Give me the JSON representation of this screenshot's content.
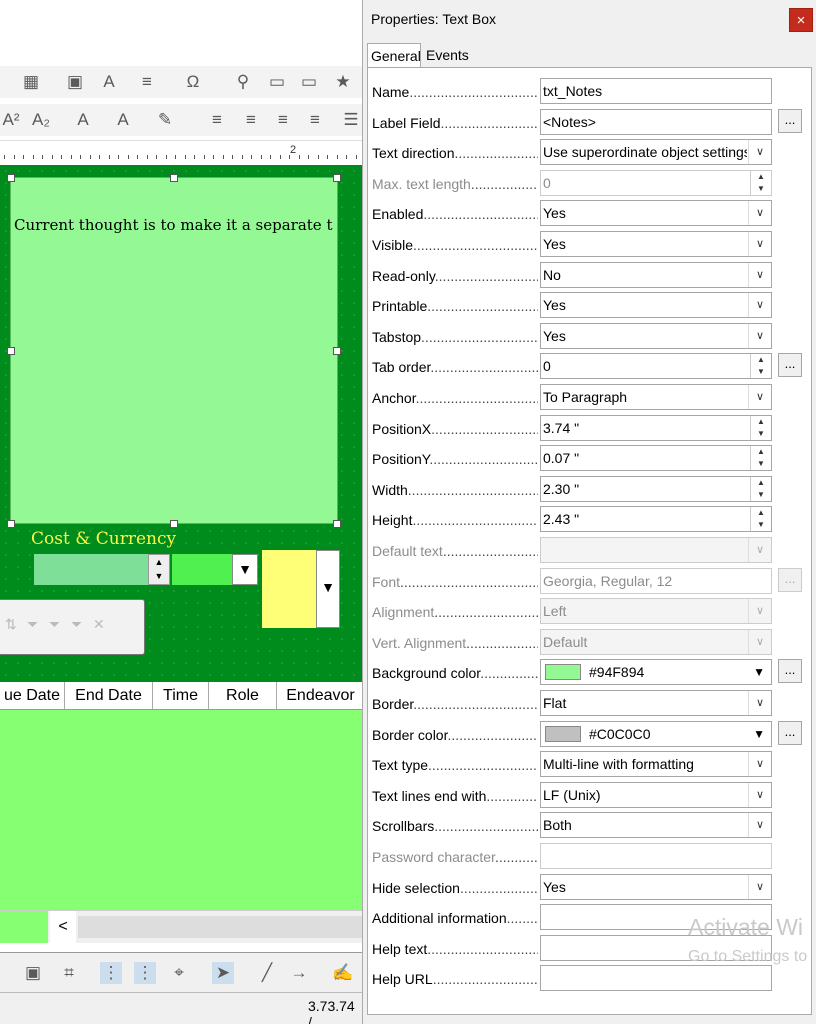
{
  "dialog": {
    "title": "Properties: Text Box",
    "close_icon": "×",
    "tabs": [
      {
        "label": "General",
        "active": true
      },
      {
        "label": "Events",
        "active": false
      }
    ]
  },
  "properties": [
    {
      "label": "Name",
      "value": "txt_Notes",
      "control": "text",
      "enabled": true
    },
    {
      "label": "Label Field",
      "value": "<Notes>",
      "control": "text",
      "enabled": true,
      "button": "..."
    },
    {
      "label": "Text direction",
      "value": "Use superordinate object settings",
      "control": "dropdown",
      "enabled": true
    },
    {
      "label": "Max. text length",
      "value": "0",
      "control": "spin",
      "enabled": false
    },
    {
      "label": "Enabled",
      "value": "Yes",
      "control": "dropdown",
      "enabled": true
    },
    {
      "label": "Visible",
      "value": "Yes",
      "control": "dropdown",
      "enabled": true
    },
    {
      "label": "Read-only",
      "value": "No",
      "control": "dropdown",
      "enabled": true
    },
    {
      "label": "Printable",
      "value": "Yes",
      "control": "dropdown",
      "enabled": true
    },
    {
      "label": "Tabstop",
      "value": "Yes",
      "control": "dropdown",
      "enabled": true
    },
    {
      "label": "Tab order",
      "value": "0",
      "control": "spin",
      "enabled": true,
      "button": "..."
    },
    {
      "label": "Anchor",
      "value": "To Paragraph",
      "control": "dropdown",
      "enabled": true
    },
    {
      "label": "PositionX",
      "value": "3.74 \"",
      "control": "spin",
      "enabled": true
    },
    {
      "label": "PositionY",
      "value": "0.07 \"",
      "control": "spin",
      "enabled": true
    },
    {
      "label": "Width",
      "value": "2.30 \"",
      "control": "spin",
      "enabled": true
    },
    {
      "label": "Height",
      "value": "2.43 \"",
      "control": "spin",
      "enabled": true
    },
    {
      "label": "Default text",
      "value": "",
      "control": "dropdown",
      "enabled": false
    },
    {
      "label": "Font",
      "value": "Georgia, Regular, 12",
      "control": "text",
      "enabled": false,
      "button": "..."
    },
    {
      "label": "Alignment",
      "value": "Left",
      "control": "dropdown",
      "enabled": false
    },
    {
      "label": "Vert. Alignment",
      "value": "Default",
      "control": "dropdown",
      "enabled": false
    },
    {
      "label": "Background color",
      "value": "#94F894",
      "control": "color",
      "swatch": "#94F894",
      "enabled": true,
      "button": "..."
    },
    {
      "label": "Border",
      "value": "Flat",
      "control": "dropdown",
      "enabled": true
    },
    {
      "label": "Border color",
      "value": "#C0C0C0",
      "control": "color",
      "swatch": "#C0C0C0",
      "enabled": true,
      "button": "..."
    },
    {
      "label": "Text type",
      "value": "Multi-line with formatting",
      "control": "dropdown",
      "enabled": true
    },
    {
      "label": "Text lines end with",
      "value": "LF (Unix)",
      "control": "dropdown",
      "enabled": true
    },
    {
      "label": "Scrollbars",
      "value": "Both",
      "control": "dropdown",
      "enabled": true
    },
    {
      "label": "Password character",
      "value": "",
      "control": "text",
      "enabled": false
    },
    {
      "label": "Hide selection",
      "value": "Yes",
      "control": "dropdown",
      "enabled": true
    },
    {
      "label": "Additional information",
      "value": "",
      "control": "text",
      "enabled": true
    },
    {
      "label": "Help text",
      "value": "",
      "control": "text",
      "enabled": true
    },
    {
      "label": "Help URL",
      "value": "",
      "control": "text",
      "enabled": true
    }
  ],
  "editor": {
    "ruler_number": "2",
    "notes_text": "Current thought is to make it a separate t",
    "cost_label": "Cost & Currency",
    "grid_columns": [
      "ue Date",
      "End Date",
      "Time",
      "Role",
      "Endeavor"
    ],
    "status_position": "3.73.74 /",
    "colors": {
      "form_bg": "#008C1D",
      "notes_bg": "#94F894",
      "grid_bg": "#87FF72",
      "cost_label": "#FFF64A"
    }
  },
  "watermark": {
    "line1": "Activate Wi",
    "line2": "Go to Settings to"
  }
}
